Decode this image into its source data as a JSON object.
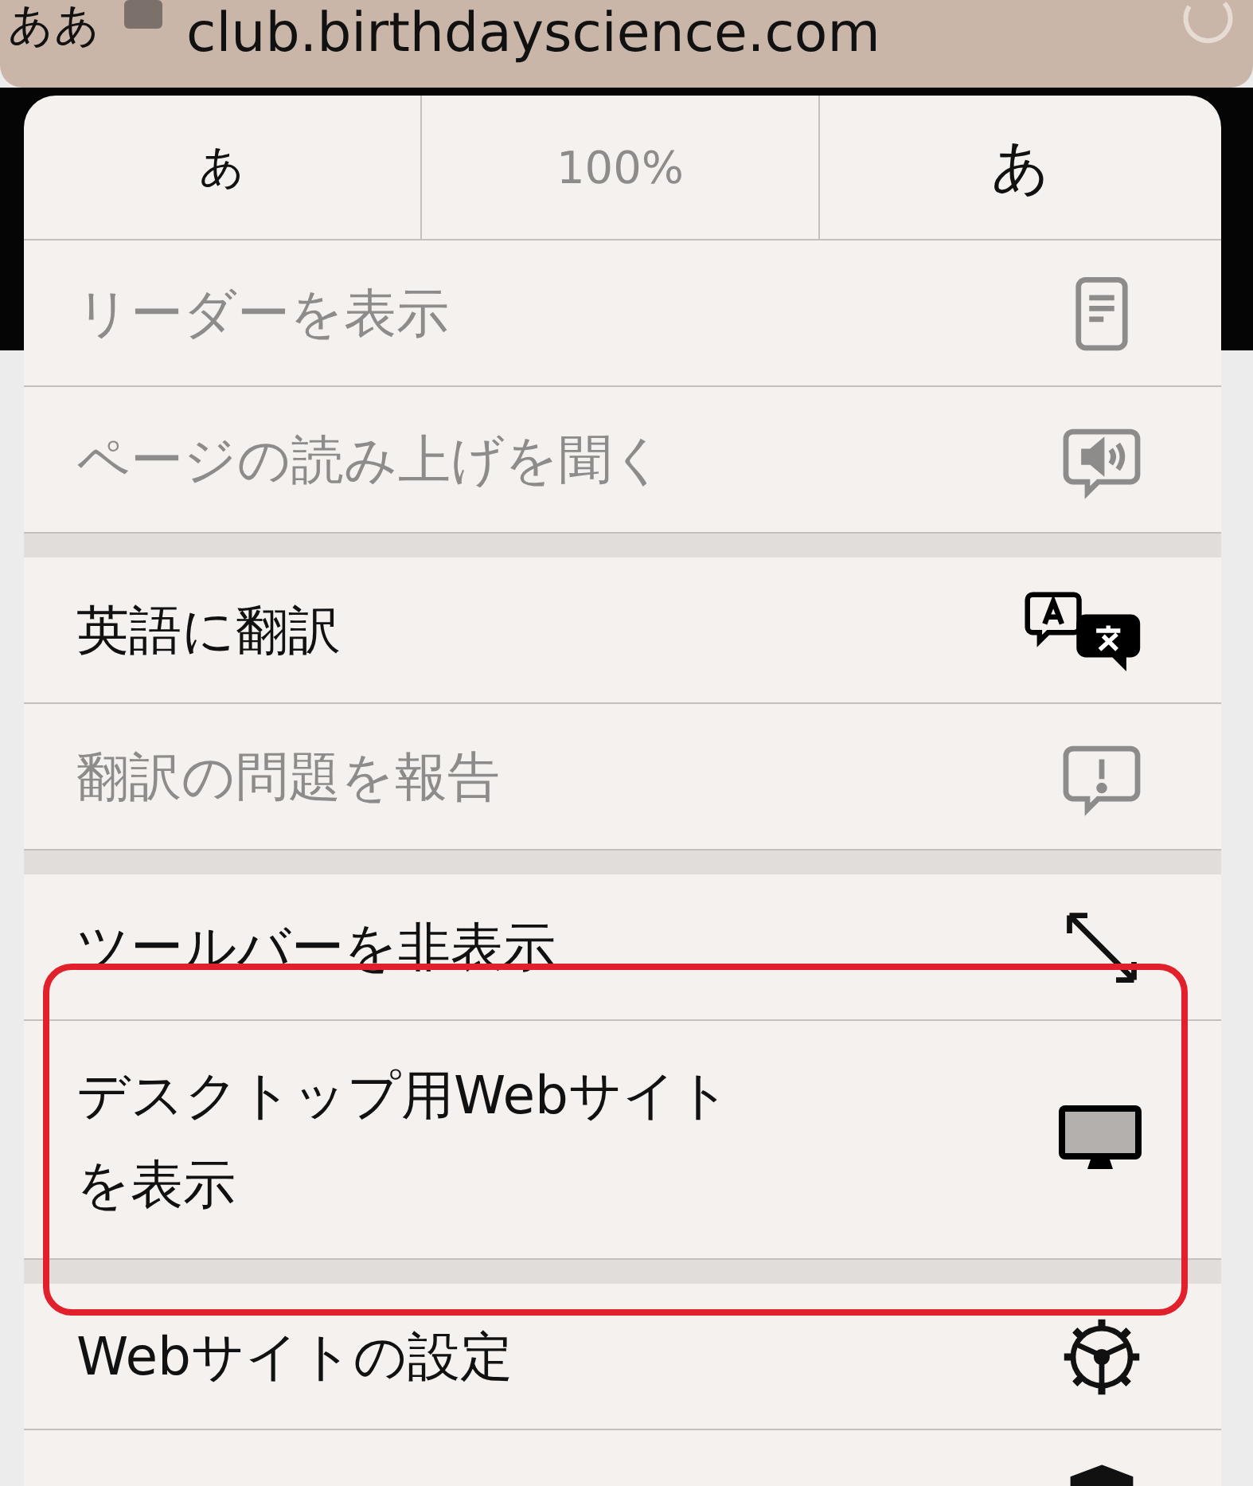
{
  "address_bar": {
    "text_size_button": "ああ",
    "url": "club.birthdayscience.com"
  },
  "menu": {
    "zoom_row": {
      "smaller": "あ",
      "zoom": "100%",
      "larger": "あ"
    },
    "items": [
      {
        "kind": "action",
        "label": "リーダーを表示",
        "disabled": true
      },
      {
        "kind": "action",
        "label": "ページの読み上げを聞く",
        "disabled": true
      },
      {
        "kind": "separator"
      },
      {
        "kind": "action",
        "label": "英語に翻訳",
        "disabled": false
      },
      {
        "kind": "action",
        "label": "翻訳の問題を報告",
        "disabled": true
      },
      {
        "kind": "separator"
      },
      {
        "kind": "action",
        "label": "ツールバーを非表示",
        "disabled": false
      },
      {
        "kind": "action",
        "label": "デスクトップ用Webサイトを表示",
        "disabled": false,
        "highlighted": true
      },
      {
        "kind": "separator"
      },
      {
        "kind": "action",
        "label": "Webサイトの設定",
        "disabled": false
      },
      {
        "kind": "action",
        "disabled": false
      }
    ]
  }
}
